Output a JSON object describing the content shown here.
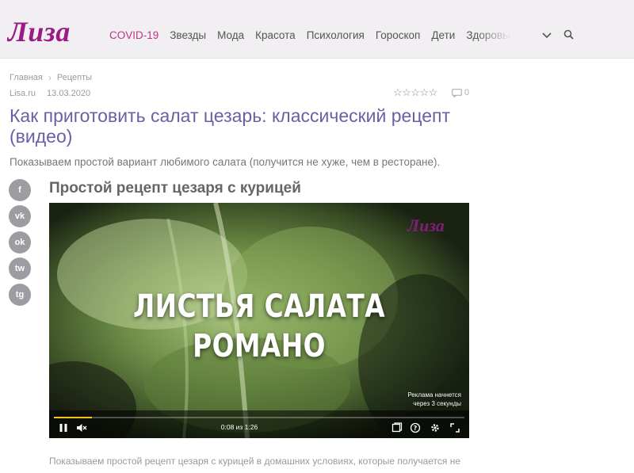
{
  "header": {
    "logo": "Лиза",
    "nav": [
      "COVID-19",
      "Звезды",
      "Мода",
      "Красота",
      "Психология",
      "Гороскоп",
      "Дети",
      "Здоровье"
    ],
    "icons": [
      "chevron-down-icon",
      "search-icon"
    ],
    "accent_color": "#c2338a",
    "logo_color": "#9b1a85"
  },
  "breadcrumbs": [
    "Главная",
    "Рецепты"
  ],
  "meta": {
    "source": "Lisa.ru",
    "date": "13.03.2020",
    "rating_max": 5,
    "comments_count": "0"
  },
  "article": {
    "title": "Как приготовить салат цезарь: классический рецепт (видео)",
    "lead": "Показываем простой вариант любимого салата (получится не хуже, чем в ресторане).",
    "subtitle": "Простой рецепт цезаря с курицей",
    "body": "Показываем простой рецепт цезаря с курицей в домашних условиях, которые получается не"
  },
  "share": {
    "buttons": [
      "facebook-icon",
      "vk-icon",
      "odnoklassniki-icon",
      "twitter-icon",
      "telegram-icon"
    ],
    "labels": [
      "f",
      "vk",
      "ok",
      "tw",
      "tg"
    ]
  },
  "video": {
    "logo": "Лиза",
    "caption_line1": "ЛИСТЬЯ САЛАТА",
    "caption_line2": "РОМАНО",
    "ad_notice_line1": "Реклама начнется",
    "ad_notice_line2": "через 3 секунды",
    "time": "0:08 из 1:26",
    "progress": 0.093,
    "progress_color": "#f0c419"
  }
}
